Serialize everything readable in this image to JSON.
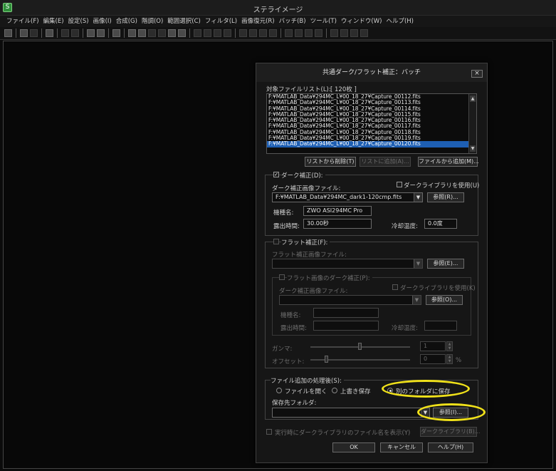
{
  "app": {
    "title": "ステライメージ"
  },
  "menu": [
    "ファイル(F)",
    "編集(E)",
    "設定(S)",
    "画像(I)",
    "合成(G)",
    "階調(O)",
    "範囲選択(C)",
    "フィルタ(L)",
    "画像復元(R)",
    "バッチ(B)",
    "ツール(T)",
    "ウィンドウ(W)",
    "ヘルプ(H)"
  ],
  "dialog": {
    "title": "共通ダーク/フラット補正：バッチ",
    "close": "×",
    "file_list_label": "対象ファイルリスト(L):",
    "file_count": "[ 120枚 ]",
    "files": [
      "F:¥MATLAB_Data¥294MC_L¥00_18_27¥Capture_00112.fits",
      "F:¥MATLAB_Data¥294MC_L¥00_18_27¥Capture_00113.fits",
      "F:¥MATLAB_Data¥294MC_L¥00_18_27¥Capture_00114.fits",
      "F:¥MATLAB_Data¥294MC_L¥00_18_27¥Capture_00115.fits",
      "F:¥MATLAB_Data¥294MC_L¥00_18_27¥Capture_00116.fits",
      "F:¥MATLAB_Data¥294MC_L¥00_18_27¥Capture_00117.fits",
      "F:¥MATLAB_Data¥294MC_L¥00_18_27¥Capture_00118.fits",
      "F:¥MATLAB_Data¥294MC_L¥00_18_27¥Capture_00119.fits",
      "F:¥MATLAB_Data¥294MC_L¥00_18_27¥Capture_00120.fits"
    ],
    "remove_btn": "リストから削除(T)",
    "add_list_btn": "リストに追加(A)...",
    "add_file_btn": "ファイルから追加(M)...",
    "dark": {
      "title": "ダーク補正(D):",
      "file_label": "ダーク補正画像ファイル:",
      "use_library": "ダークライブラリを使用(U)",
      "file_value": "F:¥MATLAB_Data¥294MC_dark1-120cmp.fits",
      "browse": "参照(R)...",
      "model_label": "機種名:",
      "model_value": "ZWO ASI294MC Pro",
      "exposure_label": "露出時間:",
      "exposure_value": "30.00秒",
      "temp_label": "冷却温度:",
      "temp_value": "0.0度",
      "check": "✓"
    },
    "flat": {
      "title": "フラット補正(F):",
      "file_label": "フラット補正画像ファイル:",
      "browse": "参照(E)...",
      "dark_sub_title": "フラット画像のダーク補正(P):",
      "dark_file_label": "ダーク補正画像ファイル:",
      "use_library": "ダークライブラリを使用(K)",
      "dark_browse": "参照(O)...",
      "model_label": "機種名:",
      "exposure_label": "露出時間:",
      "temp_label": "冷却温度:",
      "gamma_label": "ガンマ:",
      "gamma_value": "1",
      "offset_label": "オフセット:",
      "offset_value": "0",
      "offset_unit": "%"
    },
    "after": {
      "title": "ファイル追加の処理後(S):",
      "opt_open": "ファイルを開く",
      "opt_overwrite": "上書き保存",
      "opt_save_other": "別のフォルダに保存",
      "folder_label": "保存先フォルダ:",
      "browse": "参照(I)..."
    },
    "show_lib": "実行時にダークライブラリのファイル名を表示(Y)",
    "dark_lib_btn": "ダークライブラリ(B)...",
    "ok": "OK",
    "cancel": "キャンセル",
    "help": "ヘルプ(H)"
  },
  "highlight_color": "#f0e11a",
  "selection_color": "#1e5fb3"
}
